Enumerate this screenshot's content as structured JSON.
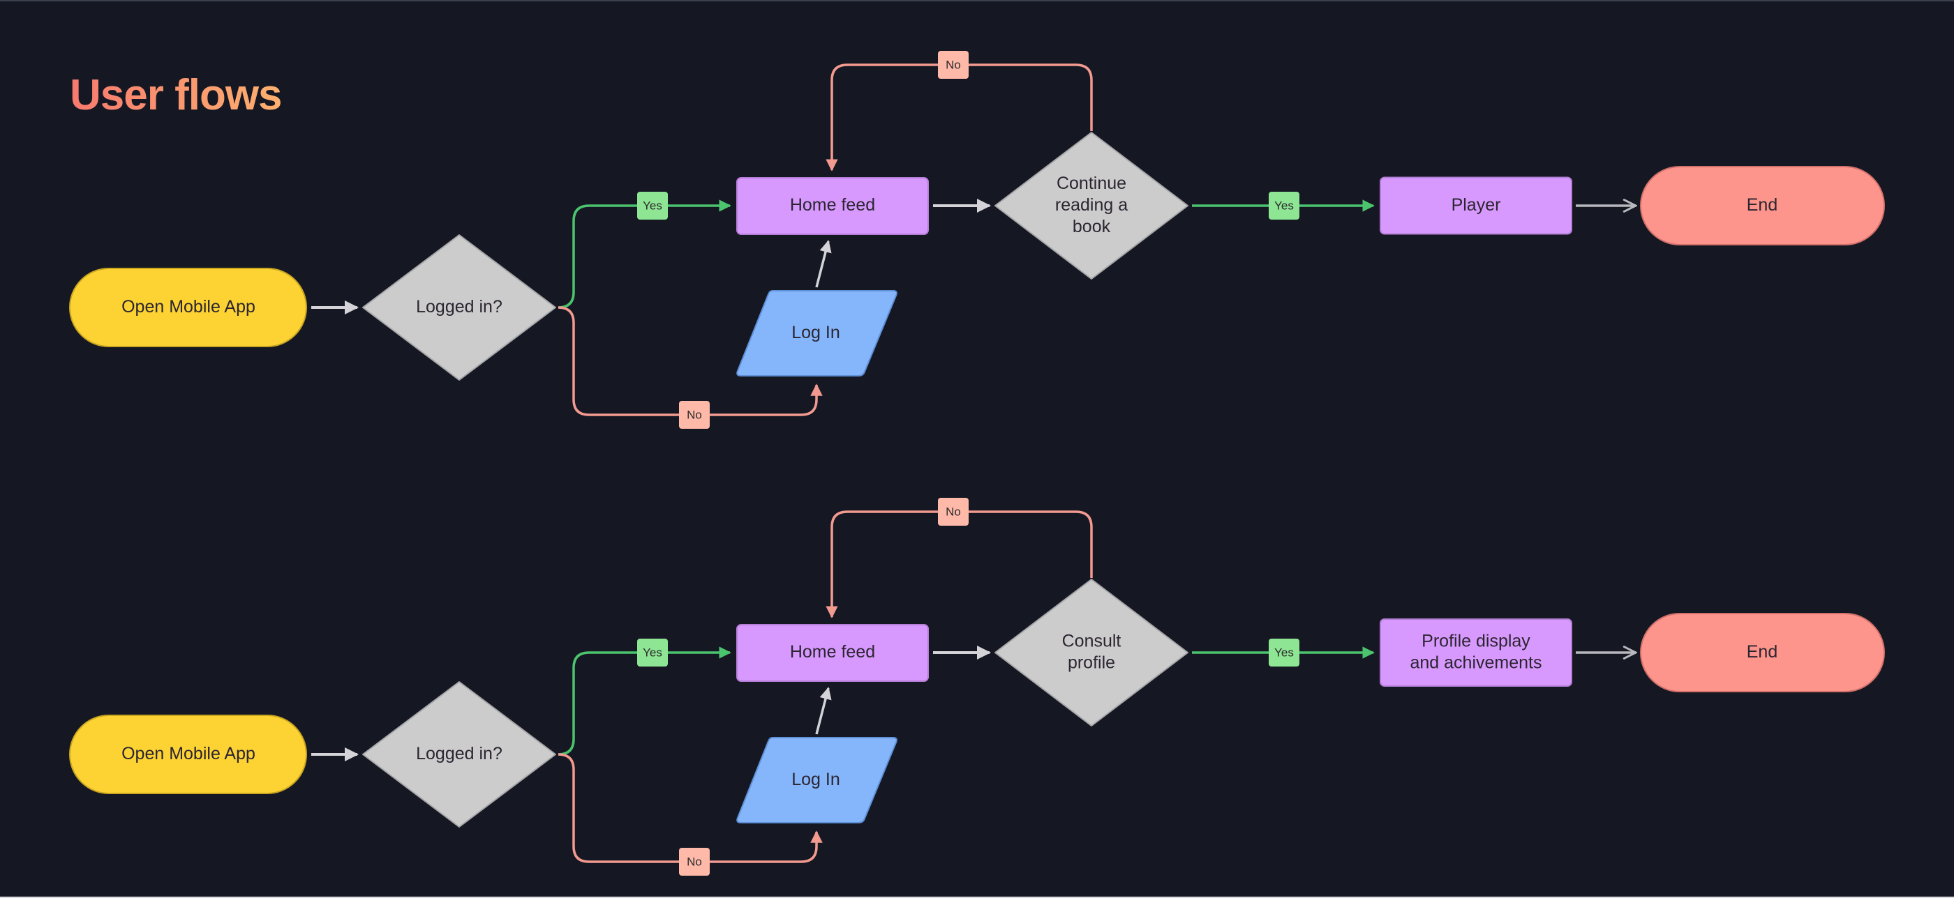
{
  "title": "User flows",
  "colors": {
    "background": "#151823",
    "title_gradient_start": "#F77A6F",
    "title_gradient_end": "#FDB16F",
    "start_node": "#FDD333",
    "decision_node": "#CDCCCD",
    "process_node": "#D899FE",
    "input_node": "#85B6FC",
    "end_node": "#FD958C",
    "yes_line": "#4CC46E",
    "yes_badge": "#8EE594",
    "no_line": "#F39A90",
    "no_badge": "#FFB9A9",
    "neutral_line": "#D4D4D8"
  },
  "flows": [
    {
      "start": "Open Mobile App",
      "decision_login": "Logged in?",
      "yes_label": "Yes",
      "no_label": "No",
      "home": "Home feed",
      "login": "Log In",
      "decision_2": [
        "Continue",
        "reading a",
        "book"
      ],
      "loop_label": "No",
      "yes_label_2": "Yes",
      "result": [
        "Player"
      ],
      "end": "End"
    },
    {
      "start": "Open Mobile App",
      "decision_login": "Logged in?",
      "yes_label": "Yes",
      "no_label": "No",
      "home": "Home feed",
      "login": "Log In",
      "decision_2": [
        "Consult",
        "profile"
      ],
      "loop_label": "No",
      "yes_label_2": "Yes",
      "result": [
        "Profile display",
        "and achivements"
      ],
      "end": "End"
    }
  ]
}
